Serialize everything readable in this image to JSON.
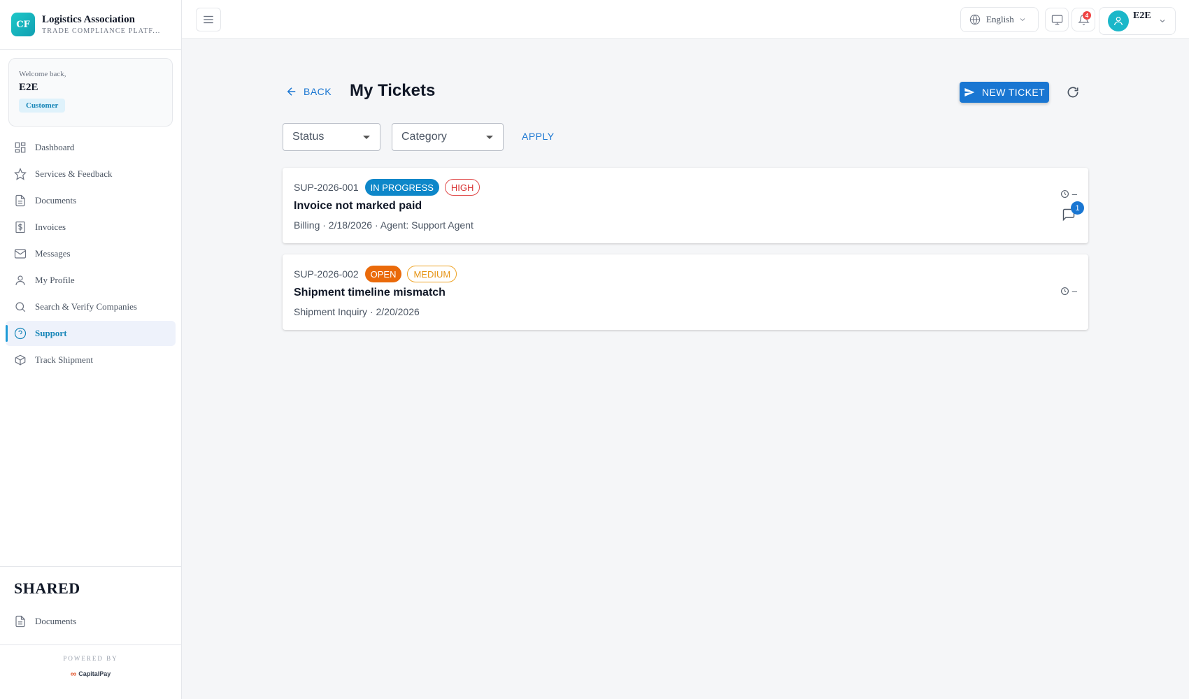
{
  "brand": {
    "logo_initials": "CF",
    "name": "Logistics Association",
    "subtitle": "TRADE COMPLIANCE PLATF..."
  },
  "welcome": {
    "greeting": "Welcome back,",
    "user_name": "E2E",
    "role": "Customer"
  },
  "sidebar": {
    "items": [
      {
        "label": "Dashboard",
        "icon": "grid-icon"
      },
      {
        "label": "Services & Feedback",
        "icon": "star-icon"
      },
      {
        "label": "Documents",
        "icon": "document-icon"
      },
      {
        "label": "Invoices",
        "icon": "dollar-icon"
      },
      {
        "label": "Messages",
        "icon": "mail-icon"
      },
      {
        "label": "My Profile",
        "icon": "user-icon"
      },
      {
        "label": "Search & Verify Companies",
        "icon": "search-icon"
      },
      {
        "label": "Support",
        "icon": "help-circle-icon",
        "active": true
      },
      {
        "label": "Track Shipment",
        "icon": "package-icon"
      }
    ],
    "shared_title": "SHARED",
    "shared_items": [
      {
        "label": "Documents",
        "icon": "document-icon"
      }
    ],
    "powered_by": "POWERED BY",
    "powered_logo": "CapitalPay"
  },
  "topbar": {
    "language": "English",
    "notifications_count": "4",
    "user_name": "E2E"
  },
  "page": {
    "back_label": "BACK",
    "title": "My Tickets",
    "new_ticket_label": "NEW TICKET",
    "filters": {
      "status_label": "Status",
      "category_label": "Category",
      "apply_label": "APPLY"
    }
  },
  "tickets": [
    {
      "id": "SUP-2026-001",
      "status": "IN PROGRESS",
      "priority": "HIGH",
      "title": "Invoice not marked paid",
      "meta": "Billing · 2/18/2026 · Agent: Support Agent",
      "time": "–",
      "comments": "1"
    },
    {
      "id": "SUP-2026-002",
      "status": "OPEN",
      "priority": "MEDIUM",
      "title": "Shipment timeline mismatch",
      "meta": "Shipment Inquiry · 2/20/2026",
      "time": "–"
    }
  ],
  "colors": {
    "primary": "#1976d2",
    "brand_teal": "#1ec8c8",
    "status_in_progress": "#0e87c9",
    "status_open": "#ea6a0a",
    "priority_high": "#d93636",
    "priority_medium": "#e69312"
  }
}
